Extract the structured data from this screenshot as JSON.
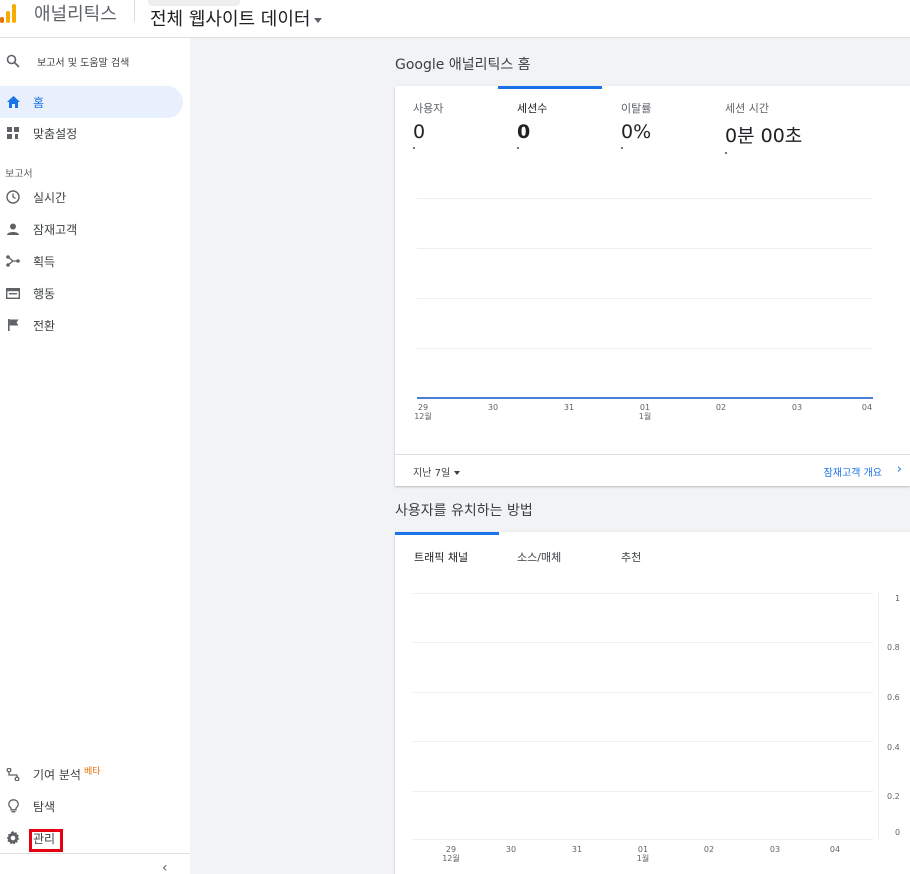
{
  "header": {
    "app_name": "애널리틱스",
    "view_name": "전체 웹사이트 데이터",
    "logo_color": "#f9ab00"
  },
  "sidebar": {
    "search": {
      "icon": "search-icon",
      "label": "보고서 및 도움말 검색"
    },
    "items": [
      {
        "icon": "home-icon",
        "label": "홈",
        "active": true
      },
      {
        "icon": "dashboard-icon",
        "label": "맞춤설정"
      }
    ],
    "section_label": "보고서",
    "reports": [
      {
        "icon": "clock-icon",
        "label": "실시간"
      },
      {
        "icon": "person-icon",
        "label": "잠재고객"
      },
      {
        "icon": "acquisition-icon",
        "label": "획득"
      },
      {
        "icon": "behavior-icon",
        "label": "행동"
      },
      {
        "icon": "flag-icon",
        "label": "전환"
      }
    ],
    "bottom": [
      {
        "icon": "attribution-icon",
        "label": "기여 분석",
        "badge": "베타"
      },
      {
        "icon": "lightbulb-icon",
        "label": "탐색"
      },
      {
        "icon": "gear-icon",
        "label": "관리"
      }
    ],
    "collapse_glyph": "‹",
    "accent_color": "#1a73e8",
    "highlight_color": "#e60012"
  },
  "home": {
    "title": "Google 애널리틱스 홈",
    "metrics": [
      {
        "label": "사용자",
        "value": "0"
      },
      {
        "label": "세션수",
        "value": "0",
        "selected": true
      },
      {
        "label": "이탈률",
        "value": "0%"
      },
      {
        "label": "세션 시간",
        "value": "0분 00초"
      }
    ],
    "x_ticks": [
      {
        "day": "29",
        "month": "12월"
      },
      {
        "day": "30",
        "month": ""
      },
      {
        "day": "31",
        "month": ""
      },
      {
        "day": "01",
        "month": "1월"
      },
      {
        "day": "02",
        "month": ""
      },
      {
        "day": "03",
        "month": ""
      },
      {
        "day": "04",
        "month": ""
      }
    ],
    "footer_left": "지난 7일",
    "footer_right": "잠재고객 개요",
    "footer_chevron": "›"
  },
  "acquire": {
    "title": "사용자를 유치하는 방법",
    "tabs": [
      {
        "label": "트래픽 채널",
        "selected": true
      },
      {
        "label": "소스/매체"
      },
      {
        "label": "추천"
      }
    ],
    "y_ticks": [
      "1",
      "0.8",
      "0.6",
      "0.4",
      "0.2",
      "0"
    ],
    "x_ticks": [
      {
        "day": "29",
        "month": "12월"
      },
      {
        "day": "30",
        "month": ""
      },
      {
        "day": "31",
        "month": ""
      },
      {
        "day": "01",
        "month": "1월"
      },
      {
        "day": "02",
        "month": ""
      },
      {
        "day": "03",
        "month": ""
      },
      {
        "day": "04",
        "month": ""
      }
    ]
  }
}
